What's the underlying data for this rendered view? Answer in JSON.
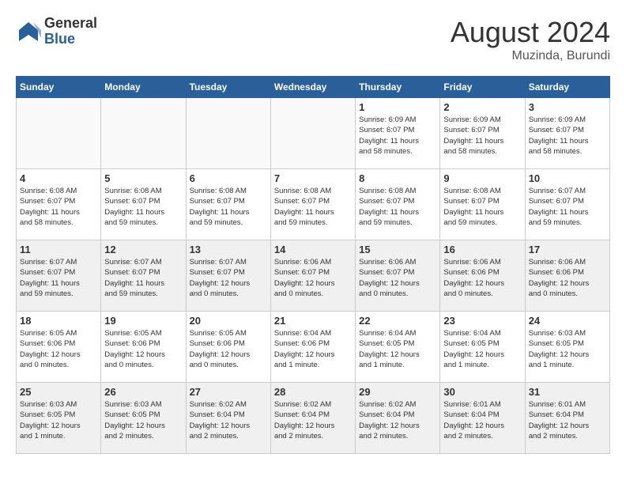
{
  "logo": {
    "general": "General",
    "blue": "Blue"
  },
  "header": {
    "month_year": "August 2024",
    "location": "Muzinda, Burundi"
  },
  "weekdays": [
    "Sunday",
    "Monday",
    "Tuesday",
    "Wednesday",
    "Thursday",
    "Friday",
    "Saturday"
  ],
  "weeks": [
    [
      {
        "day": "",
        "empty": true
      },
      {
        "day": "",
        "empty": true
      },
      {
        "day": "",
        "empty": true
      },
      {
        "day": "",
        "empty": true
      },
      {
        "day": "1",
        "info": "Sunrise: 6:09 AM\nSunset: 6:07 PM\nDaylight: 11 hours\nand 58 minutes."
      },
      {
        "day": "2",
        "info": "Sunrise: 6:09 AM\nSunset: 6:07 PM\nDaylight: 11 hours\nand 58 minutes."
      },
      {
        "day": "3",
        "info": "Sunrise: 6:09 AM\nSunset: 6:07 PM\nDaylight: 11 hours\nand 58 minutes."
      }
    ],
    [
      {
        "day": "4",
        "info": "Sunrise: 6:08 AM\nSunset: 6:07 PM\nDaylight: 11 hours\nand 58 minutes."
      },
      {
        "day": "5",
        "info": "Sunrise: 6:08 AM\nSunset: 6:07 PM\nDaylight: 11 hours\nand 59 minutes."
      },
      {
        "day": "6",
        "info": "Sunrise: 6:08 AM\nSunset: 6:07 PM\nDaylight: 11 hours\nand 59 minutes."
      },
      {
        "day": "7",
        "info": "Sunrise: 6:08 AM\nSunset: 6:07 PM\nDaylight: 11 hours\nand 59 minutes."
      },
      {
        "day": "8",
        "info": "Sunrise: 6:08 AM\nSunset: 6:07 PM\nDaylight: 11 hours\nand 59 minutes."
      },
      {
        "day": "9",
        "info": "Sunrise: 6:08 AM\nSunset: 6:07 PM\nDaylight: 11 hours\nand 59 minutes."
      },
      {
        "day": "10",
        "info": "Sunrise: 6:07 AM\nSunset: 6:07 PM\nDaylight: 11 hours\nand 59 minutes."
      }
    ],
    [
      {
        "day": "11",
        "info": "Sunrise: 6:07 AM\nSunset: 6:07 PM\nDaylight: 11 hours\nand 59 minutes."
      },
      {
        "day": "12",
        "info": "Sunrise: 6:07 AM\nSunset: 6:07 PM\nDaylight: 11 hours\nand 59 minutes."
      },
      {
        "day": "13",
        "info": "Sunrise: 6:07 AM\nSunset: 6:07 PM\nDaylight: 12 hours\nand 0 minutes."
      },
      {
        "day": "14",
        "info": "Sunrise: 6:06 AM\nSunset: 6:07 PM\nDaylight: 12 hours\nand 0 minutes."
      },
      {
        "day": "15",
        "info": "Sunrise: 6:06 AM\nSunset: 6:07 PM\nDaylight: 12 hours\nand 0 minutes."
      },
      {
        "day": "16",
        "info": "Sunrise: 6:06 AM\nSunset: 6:06 PM\nDaylight: 12 hours\nand 0 minutes."
      },
      {
        "day": "17",
        "info": "Sunrise: 6:06 AM\nSunset: 6:06 PM\nDaylight: 12 hours\nand 0 minutes."
      }
    ],
    [
      {
        "day": "18",
        "info": "Sunrise: 6:05 AM\nSunset: 6:06 PM\nDaylight: 12 hours\nand 0 minutes."
      },
      {
        "day": "19",
        "info": "Sunrise: 6:05 AM\nSunset: 6:06 PM\nDaylight: 12 hours\nand 0 minutes."
      },
      {
        "day": "20",
        "info": "Sunrise: 6:05 AM\nSunset: 6:06 PM\nDaylight: 12 hours\nand 0 minutes."
      },
      {
        "day": "21",
        "info": "Sunrise: 6:04 AM\nSunset: 6:06 PM\nDaylight: 12 hours\nand 1 minute."
      },
      {
        "day": "22",
        "info": "Sunrise: 6:04 AM\nSunset: 6:05 PM\nDaylight: 12 hours\nand 1 minute."
      },
      {
        "day": "23",
        "info": "Sunrise: 6:04 AM\nSunset: 6:05 PM\nDaylight: 12 hours\nand 1 minute."
      },
      {
        "day": "24",
        "info": "Sunrise: 6:03 AM\nSunset: 6:05 PM\nDaylight: 12 hours\nand 1 minute."
      }
    ],
    [
      {
        "day": "25",
        "info": "Sunrise: 6:03 AM\nSunset: 6:05 PM\nDaylight: 12 hours\nand 1 minute."
      },
      {
        "day": "26",
        "info": "Sunrise: 6:03 AM\nSunset: 6:05 PM\nDaylight: 12 hours\nand 2 minutes."
      },
      {
        "day": "27",
        "info": "Sunrise: 6:02 AM\nSunset: 6:04 PM\nDaylight: 12 hours\nand 2 minutes."
      },
      {
        "day": "28",
        "info": "Sunrise: 6:02 AM\nSunset: 6:04 PM\nDaylight: 12 hours\nand 2 minutes."
      },
      {
        "day": "29",
        "info": "Sunrise: 6:02 AM\nSunset: 6:04 PM\nDaylight: 12 hours\nand 2 minutes."
      },
      {
        "day": "30",
        "info": "Sunrise: 6:01 AM\nSunset: 6:04 PM\nDaylight: 12 hours\nand 2 minutes."
      },
      {
        "day": "31",
        "info": "Sunrise: 6:01 AM\nSunset: 6:04 PM\nDaylight: 12 hours\nand 2 minutes."
      }
    ]
  ]
}
